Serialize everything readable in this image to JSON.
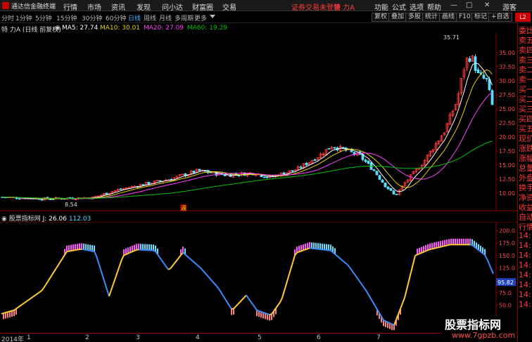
{
  "menubar": {
    "app_name": "通达信金融终端",
    "items": [
      "行情",
      "市场",
      "资讯",
      "发现",
      "问小达",
      "财富圈",
      "交易"
    ],
    "notice": "证券交易未登录",
    "stock_name": "特 力A",
    "right_items": [
      "功能",
      "公式",
      "选项",
      "帮助"
    ],
    "guest": "游客"
  },
  "periods": [
    "分时",
    "1分钟",
    "5分钟",
    "15分钟",
    "30分钟",
    "60分钟",
    "日线",
    "周线",
    "月线",
    "多周期",
    "更多"
  ],
  "active_period": "日线",
  "toolbar": [
    "复权",
    "叠加",
    "多股",
    "统计",
    "画线",
    "F10",
    "标记",
    "+自选"
  ],
  "indicators": {
    "title": "特 力A (日线 前复权)",
    "ma5": "MA5: 27.74",
    "ma10": "MA10: 30.01",
    "ma20": "MA20: 27.09",
    "ma60": "MA60: 19.29"
  },
  "colors": {
    "ma5": "#ffffff",
    "ma10": "#e6d400",
    "ma20": "#ff40ff",
    "ma60": "#00c000",
    "up": "#ff3b3b",
    "down": "#55e0ff",
    "axis": "#8b0000"
  },
  "price_axis": [
    "35.00",
    "32.50",
    "30.00",
    "27.50",
    "25.00",
    "22.50",
    "20.00",
    "17.50",
    "15.00",
    "12.50",
    "10.00"
  ],
  "price_marks": {
    "high": "35.71",
    "low": "8.54"
  },
  "kdj": {
    "title": "股票指标网",
    "j_value": "J: 26.06",
    "extra": "112.03",
    "axis": [
      "200.0",
      "175.0",
      "150.0",
      "125.0",
      "100.0",
      "75.0",
      "50.0",
      "25.0"
    ],
    "current_tag": "95.82"
  },
  "date_axis": [
    "2014年",
    "1",
    "2",
    "3",
    "4",
    "5",
    "6",
    "7",
    "8"
  ],
  "right_panel": [
    "委比",
    "卖五",
    "卖四",
    "卖三",
    "卖二",
    "卖一",
    "买一",
    "买二",
    "买三",
    "买四",
    "买五",
    "现价",
    "涨跌",
    "涨幅",
    "总量",
    "外盘",
    "换手",
    "净资",
    "收益",
    "自动",
    "行情",
    "14:50",
    "14:50",
    "14:50",
    "14:50",
    "14:50",
    "14:50",
    "14:50",
    "14:50"
  ],
  "watermark": {
    "line1": "股票指标网",
    "line2": "www.7gpzb.com"
  },
  "event_tag": "週"
}
